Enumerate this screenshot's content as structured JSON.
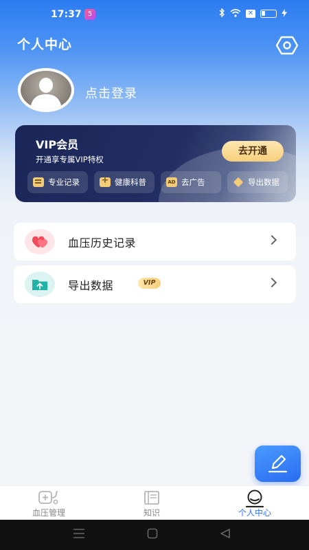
{
  "status_bar": {
    "time": "17:37",
    "notif_label": "5",
    "x_label": "✕"
  },
  "header": {
    "title": "个人中心"
  },
  "profile": {
    "login_text": "点击登录"
  },
  "vip_card": {
    "title": "VIP会员",
    "subtitle": "开通享专属VIP特权",
    "open_button": "去开通",
    "features": [
      {
        "label": "专业记录",
        "icon": "document-icon"
      },
      {
        "label": "健康科普",
        "icon": "medkit-icon"
      },
      {
        "label": "去广告",
        "icon": "ad-icon",
        "icon_text": "AD"
      },
      {
        "label": "导出数据",
        "icon": "box-icon"
      }
    ]
  },
  "menu": [
    {
      "label": "血压历史记录",
      "icon": "hearts-icon"
    },
    {
      "label": "导出数据",
      "icon": "folder-upload-icon",
      "badge": "VIP"
    }
  ],
  "tabbar": {
    "items": [
      {
        "label": "血压管理",
        "icon": "bp-monitor-icon",
        "active": false
      },
      {
        "label": "知识",
        "icon": "book-icon",
        "active": false
      },
      {
        "label": "个人中心",
        "icon": "person-icon",
        "active": true
      }
    ]
  },
  "colors": {
    "accent": "#2b6ff2",
    "vip_gold": "#f6cf7d",
    "vip_card_bg": "#1a2657",
    "header_blue": "#2c7cf2"
  }
}
